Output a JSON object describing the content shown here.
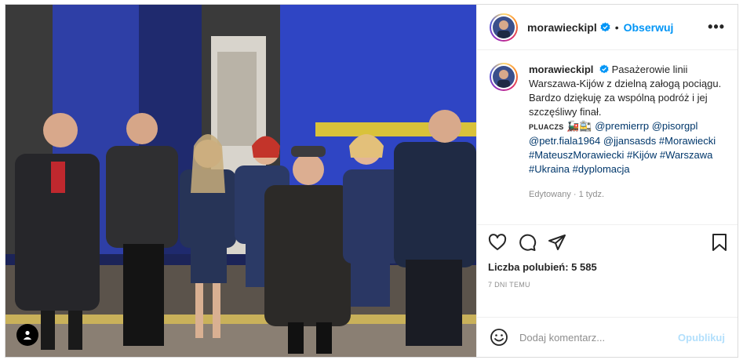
{
  "colors": {
    "accent": "#0095f6",
    "link": "#00376b",
    "text": "#262626",
    "muted": "#8e8e8e",
    "verified": "#0095f6",
    "train_blue": "#2b3fa8",
    "train_yellow": "#d9c23a"
  },
  "header": {
    "username": "morawieckipl",
    "separator": "•",
    "follow_label": "Obserwuj",
    "more_label": "•••"
  },
  "caption": {
    "username": "morawieckipl",
    "text": "Pasażerowie linii Warszawa-Kijów z dzielną załogą pociągu. Bardzo dziękuję za wspólną podróż i jej szczęśliwy finał.",
    "plu_text": "PLUACZS",
    "mentions": [
      "@premierrp",
      "@pisorgpl",
      "@petr.fiala1964",
      "@jjansasds"
    ],
    "hashtags": [
      "#Morawiecki",
      "#MateuszMorawiecki",
      "#Kijów",
      "#Warszawa",
      "#Ukraina",
      "#dyplomacja"
    ],
    "edited": "Edytowany",
    "meta_separator": "·",
    "age": "1 tydz."
  },
  "actions": {
    "like_icon": "heart-icon",
    "comment_icon": "comment-icon",
    "share_icon": "share-icon",
    "save_icon": "bookmark-icon",
    "likes_label": "Liczba polubień: 5 585",
    "date_label": "7 DNI TEMU"
  },
  "comment_box": {
    "placeholder": "Dodaj komentarz...",
    "post_label": "Opublikuj",
    "emoji_icon": "emoji-icon"
  },
  "photo": {
    "tag_icon": "user-tag-icon"
  }
}
